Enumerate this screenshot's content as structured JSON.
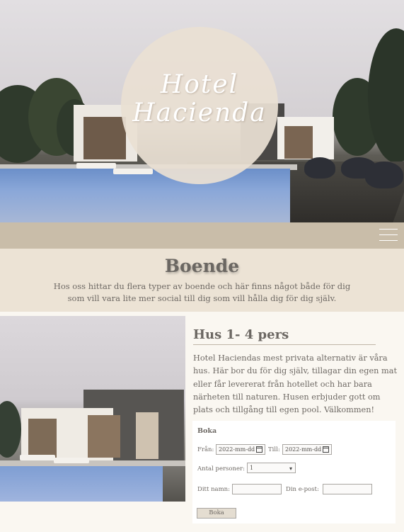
{
  "hero": {
    "logo_line1": "Hotel",
    "logo_line2": "Hacienda"
  },
  "nav": {
    "menu_icon": "hamburger-menu-icon"
  },
  "intro": {
    "title": "Boende",
    "text": "Hos oss hittar du flera typer av boende och här finns något både för dig som vill vara lite mer social till dig som vill hålla dig för dig själv."
  },
  "house": {
    "title": "Hus 1- 4 pers",
    "description": "Hotel Haciendas mest privata alternativ är våra hus. Här bor du för dig själv, tillagar din egen mat eller får levererat från hotellet och har bara närheten till naturen. Husen erbjuder gott om plats och tillgång till egen pool. Välkommen!"
  },
  "booking": {
    "title": "Boka",
    "from_label": "Från:",
    "from_value": "2022-mm-dd",
    "to_label": "Till:",
    "to_value": "2022-mm-dd",
    "persons_label": "Antal personer:",
    "persons_value": "1",
    "name_label": "Ditt namn:",
    "name_value": "",
    "email_label": "Din e-post:",
    "email_value": "",
    "submit_label": "Boka"
  },
  "colors": {
    "navbar": "#c9bda9",
    "intro_bg": "#ece3d5",
    "page_bg": "#faf7f1",
    "logo_circle": "#e9e0d3"
  }
}
